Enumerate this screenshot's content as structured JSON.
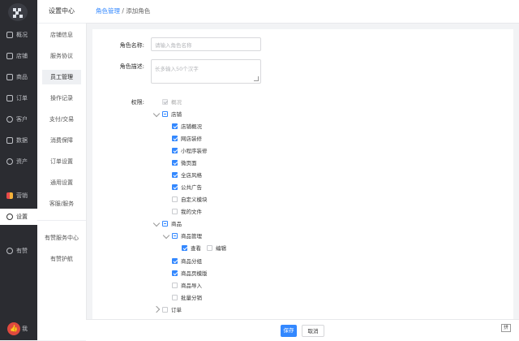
{
  "sidebar": {
    "items": [
      {
        "label": "概况",
        "icon": "monitor-icon"
      },
      {
        "label": "店铺",
        "icon": "store-icon"
      },
      {
        "label": "商品",
        "icon": "tag-icon"
      },
      {
        "label": "订单",
        "icon": "document-icon"
      },
      {
        "label": "客户",
        "icon": "person-icon"
      },
      {
        "label": "数据",
        "icon": "chart-icon"
      },
      {
        "label": "资产",
        "icon": "coin-icon"
      },
      {
        "label": "营销",
        "icon": "grid-icon"
      },
      {
        "label": "设置",
        "icon": "gear-icon"
      },
      {
        "label": "有赞",
        "icon": "thumb-icon"
      }
    ],
    "footer_label": "我",
    "active": "设置"
  },
  "subnav": {
    "title": "设置中心",
    "items": [
      "店铺信息",
      "服务协议",
      "员工管理",
      "操作记录",
      "支付/交易",
      "消费保障",
      "订单设置",
      "通用设置",
      "客服/服务"
    ],
    "extra": [
      "有赞服务中心",
      "有赞护航"
    ],
    "active": "员工管理"
  },
  "breadcrumb": {
    "parent": "角色管理",
    "sep": " / ",
    "current": "添加角色"
  },
  "form": {
    "role_name_label": "角色名称:",
    "role_name_placeholder": "请输入角色名称",
    "role_desc_label": "角色描述:",
    "role_desc_placeholder": "长多输入50个汉字",
    "perm_label": "权限:"
  },
  "tree": [
    {
      "label": "概况",
      "state": "disabled"
    },
    {
      "label": "店铺",
      "state": "half"
    },
    {
      "label": "店铺概况",
      "state": "checked"
    },
    {
      "label": "网店装修",
      "state": "checked"
    },
    {
      "label": "小程序装修",
      "state": "checked"
    },
    {
      "label": "微页面",
      "state": "checked"
    },
    {
      "label": "全店风格",
      "state": "checked"
    },
    {
      "label": "公共广告",
      "state": "checked"
    },
    {
      "label": "自定义模块",
      "state": "unchecked"
    },
    {
      "label": "我的文件",
      "state": "unchecked"
    },
    {
      "label": "商品",
      "state": "half"
    },
    {
      "label": "商品管理",
      "state": "half"
    },
    {
      "label": "查看",
      "state": "checked"
    },
    {
      "label": "编辑",
      "state": "unchecked"
    },
    {
      "label": "商品分组",
      "state": "checked"
    },
    {
      "label": "商品页模版",
      "state": "checked"
    },
    {
      "label": "商品导入",
      "state": "unchecked"
    },
    {
      "label": "批量分销",
      "state": "unchecked"
    },
    {
      "label": "订单",
      "state": "unchecked"
    }
  ],
  "footer": {
    "save_label": "保存",
    "cancel_label": "取消",
    "corner_label": "拼"
  },
  "colors": {
    "accent": "#3388ff",
    "sidebar_bg": "#2b2c31",
    "page_bg": "#f2f3f5"
  }
}
